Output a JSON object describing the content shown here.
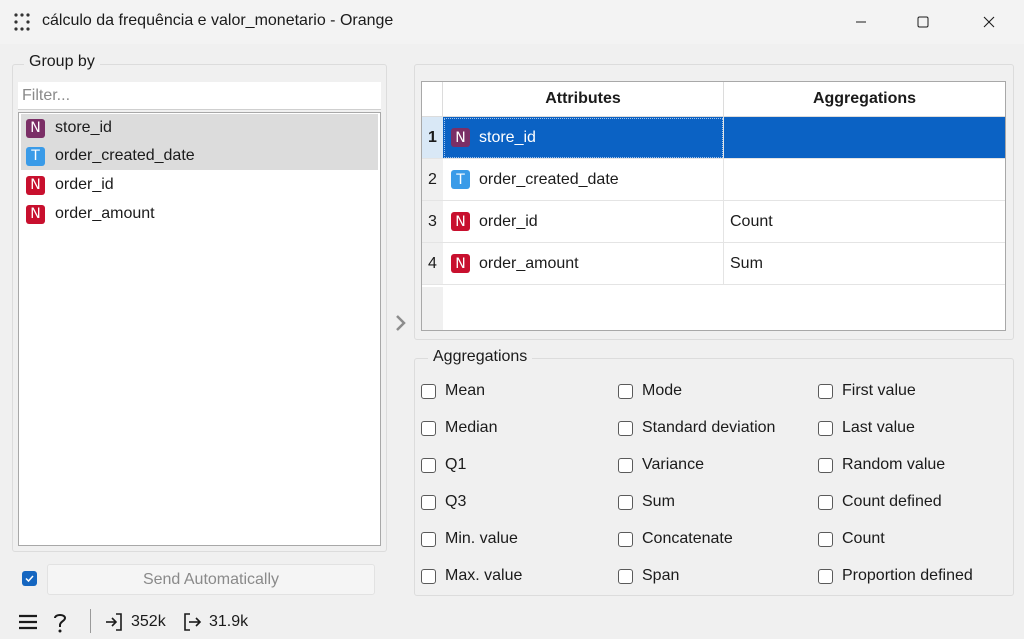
{
  "window": {
    "title": "cálculo da frequência e valor_monetario - Orange",
    "app_icon": "orange-dots-icon"
  },
  "group_by": {
    "title": "Group by",
    "filter_placeholder": "Filter...",
    "items": [
      {
        "type": "N",
        "kind": "discrete",
        "label": "store_id",
        "selected": true
      },
      {
        "type": "T",
        "kind": "time",
        "label": "order_created_date",
        "selected": true
      },
      {
        "type": "N",
        "kind": "numeric",
        "label": "order_id",
        "selected": false
      },
      {
        "type": "N",
        "kind": "numeric",
        "label": "order_amount",
        "selected": false
      }
    ]
  },
  "send": {
    "checked": true,
    "label": "Send Automatically"
  },
  "table": {
    "headers": {
      "attributes": "Attributes",
      "aggregations": "Aggregations"
    },
    "rows": [
      {
        "num": "1",
        "type": "N",
        "kind": "discrete",
        "attribute": "store_id",
        "aggregation": "",
        "selected": true
      },
      {
        "num": "2",
        "type": "T",
        "kind": "time",
        "attribute": "order_created_date",
        "aggregation": "",
        "selected": false
      },
      {
        "num": "3",
        "type": "N",
        "kind": "numeric",
        "attribute": "order_id",
        "aggregation": "Count",
        "selected": false
      },
      {
        "num": "4",
        "type": "N",
        "kind": "numeric",
        "attribute": "order_amount",
        "aggregation": "Sum",
        "selected": false
      }
    ]
  },
  "aggregations": {
    "title": "Aggregations",
    "col1": [
      "Mean",
      "Median",
      "Q1",
      "Q3",
      "Min. value",
      "Max. value"
    ],
    "col2": [
      "Mode",
      "Standard deviation",
      "Variance",
      "Sum",
      "Concatenate",
      "Span"
    ],
    "col3": [
      "First value",
      "Last value",
      "Random value",
      "Count defined",
      "Count",
      "Proportion defined"
    ]
  },
  "status": {
    "input_size": "352k",
    "output_size": "31.9k"
  },
  "colors": {
    "accent": "#0b62c4",
    "discrete": "#7b2f66",
    "numeric": "#c8102e",
    "time": "#3a9be8"
  }
}
